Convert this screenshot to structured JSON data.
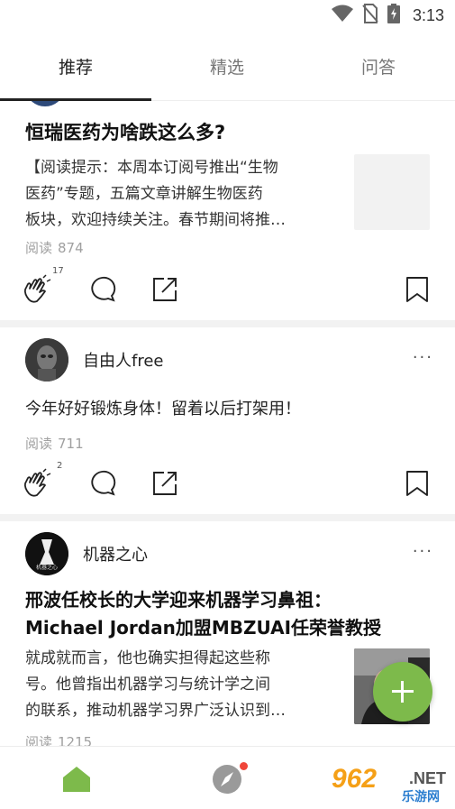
{
  "status_bar": {
    "time": "3:13"
  },
  "tabs": [
    {
      "label": "推荐",
      "active": true
    },
    {
      "label": "精选",
      "active": false
    },
    {
      "label": "问答",
      "active": false
    }
  ],
  "posts": [
    {
      "title": "恒瑞医药为啥跌这么多?",
      "excerpt_lines": [
        "【阅读提示：本周本订阅号推出“生物",
        "医药”专题，五篇文章讲解生物医药",
        "板块，欢迎持续关注。春节期间将推…"
      ],
      "read_label": "阅读",
      "read_count": "874",
      "clap_count": "17"
    },
    {
      "author": "自由人free",
      "more": "···",
      "text": "今年好好锻炼身体！留着以后打架用！",
      "read_label": "阅读",
      "read_count": "711",
      "clap_count": "2"
    },
    {
      "author": "机器之心",
      "avatar_text": "机器之心",
      "more": "···",
      "title_lines": [
        "邢波任校长的大学迎来机器学习鼻祖：",
        "Michael Jordan加盟MBZUAI任荣誉教授"
      ],
      "excerpt_lines": [
        "就成就而言，他也确实担得起这些称",
        "号。他曾指出机器学习与统计学之间",
        "的联系，推动机器学习界广泛认识到…"
      ],
      "read_label": "阅读",
      "read_count": "1215"
    }
  ],
  "colors": {
    "accent_green": "#7dba4b",
    "badge_red": "#f0463a"
  },
  "watermark": {
    "brand": "962",
    "net": ".NET",
    "sub": "乐游网"
  }
}
